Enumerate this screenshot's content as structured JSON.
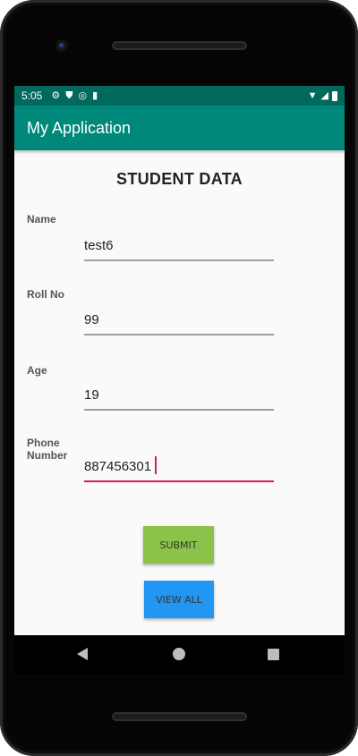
{
  "status_bar": {
    "time": "5:05",
    "left_icons": [
      "settings-icon",
      "shield-icon",
      "sync-icon",
      "sd-card-icon"
    ],
    "right_icons": [
      "wifi-icon",
      "signal-icon",
      "battery-icon"
    ]
  },
  "app_bar": {
    "title": "My Application"
  },
  "form": {
    "heading": "STUDENT DATA",
    "fields": [
      {
        "label": "Name",
        "value": "test6"
      },
      {
        "label": "Roll No",
        "value": "99"
      },
      {
        "label": "Age",
        "value": "19"
      },
      {
        "label": "Phone Number",
        "value": "887456301",
        "focused": true
      }
    ],
    "submit_label": "SUBMIT",
    "view_all_label": "VIEW ALL"
  },
  "colors": {
    "status_bar": "#00695c",
    "app_bar": "#00897b",
    "focus_underline": "#d81b60",
    "submit_button": "#8bc34a",
    "view_all_button": "#2196f3"
  },
  "nav_bar": {
    "icons": [
      "back-icon",
      "home-icon",
      "recents-icon"
    ]
  }
}
